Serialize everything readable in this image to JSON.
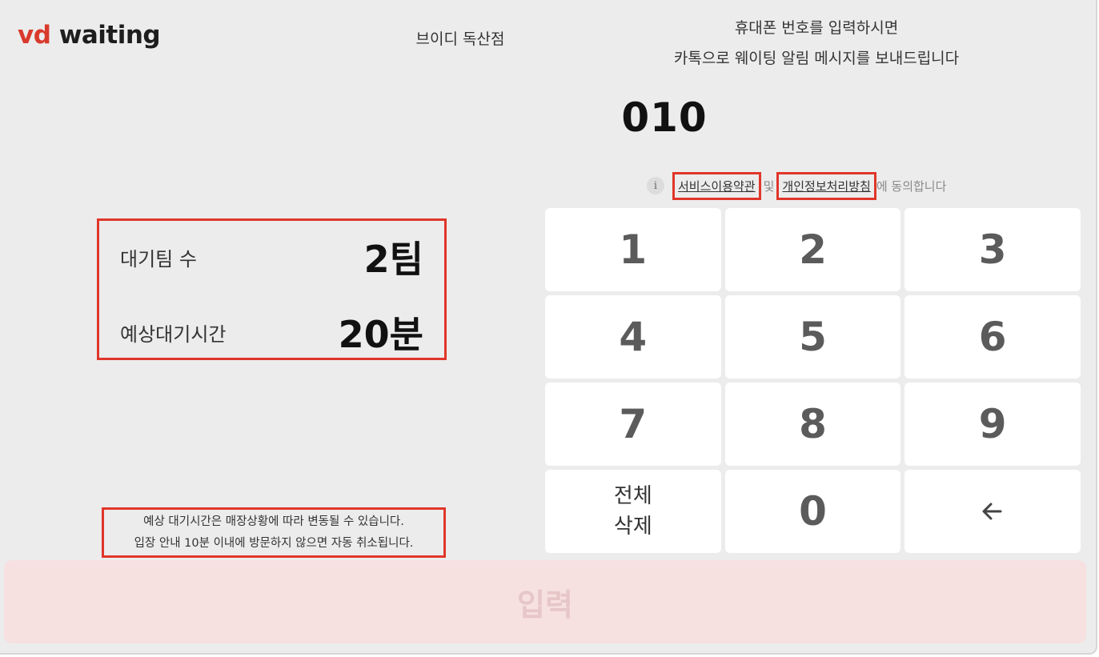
{
  "brand": {
    "logo_vd": "vd",
    "logo_waiting": "waiting",
    "accent_color": "#d83a2c"
  },
  "header": {
    "store_name": "브이디 독산점",
    "instruction_line1": "휴대폰 번호를 입력하시면",
    "instruction_line2": "카톡으로 웨이팅 알림 메시지를 보내드립니다"
  },
  "phone_input": {
    "value": "010"
  },
  "consent": {
    "info_icon": "i",
    "terms_link": "서비스이용약관",
    "connector": "및",
    "privacy_link": "개인정보처리방침",
    "suffix": "에 동의합니다"
  },
  "wait_info": {
    "teams_label": "대기팀 수",
    "teams_value": "2팀",
    "time_label": "예상대기시간",
    "time_value": "20분"
  },
  "notice": {
    "line1": "예상 대기시간은 매장상황에 따라 변동될 수 있습니다.",
    "line2": "입장 안내 10분 이내에 방문하지 않으면 자동 취소됩니다."
  },
  "keypad": {
    "k1": "1",
    "k2": "2",
    "k3": "3",
    "k4": "4",
    "k5": "5",
    "k6": "6",
    "k7": "7",
    "k8": "8",
    "k9": "9",
    "clear_line1": "전체",
    "clear_line2": "삭제",
    "k0": "0",
    "backspace_icon": "arrow-left-icon"
  },
  "submit": {
    "label": "입력",
    "background": "#f7e0e0"
  }
}
